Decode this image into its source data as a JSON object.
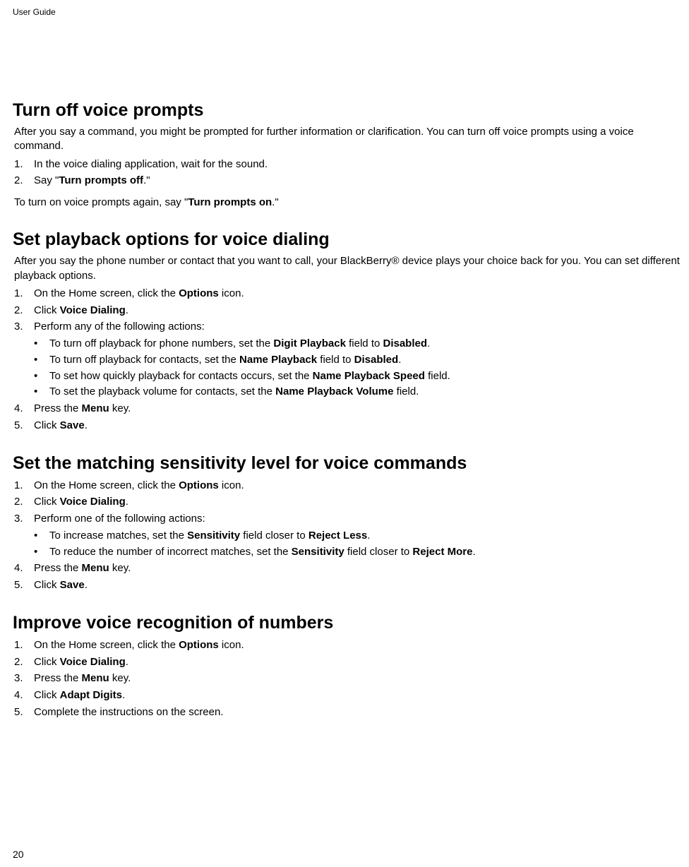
{
  "header": {
    "label": "User Guide"
  },
  "page_number": "20",
  "sections": [
    {
      "heading": "Turn off voice prompts",
      "intro": "After you say a command, you might be prompted for further information or clarification. You can turn off voice prompts using a voice command.",
      "steps": [
        {
          "n": "1.",
          "runs": [
            {
              "t": "In the voice dialing application, wait for the sound."
            }
          ]
        },
        {
          "n": "2.",
          "runs": [
            {
              "t": "Say \""
            },
            {
              "t": "Turn prompts off",
              "b": true
            },
            {
              "t": ".\""
            }
          ]
        }
      ],
      "note_runs": [
        {
          "t": "To turn on voice prompts again, say \""
        },
        {
          "t": "Turn prompts on",
          "b": true
        },
        {
          "t": ".\""
        }
      ]
    },
    {
      "heading": "Set playback options for voice dialing",
      "intro": "After you say the phone number or contact that you want to call, your BlackBerry® device plays your choice back for you. You can set different playback options.",
      "steps": [
        {
          "n": "1.",
          "runs": [
            {
              "t": "On the Home screen, click the "
            },
            {
              "t": "Options",
              "b": true
            },
            {
              "t": " icon."
            }
          ]
        },
        {
          "n": "2.",
          "runs": [
            {
              "t": "Click "
            },
            {
              "t": "Voice Dialing",
              "b": true
            },
            {
              "t": "."
            }
          ]
        },
        {
          "n": "3.",
          "runs": [
            {
              "t": "Perform any of the following actions:"
            }
          ],
          "sub": [
            [
              {
                "t": "To turn off playback for phone numbers, set the "
              },
              {
                "t": "Digit Playback",
                "b": true
              },
              {
                "t": " field to "
              },
              {
                "t": "Disabled",
                "b": true
              },
              {
                "t": "."
              }
            ],
            [
              {
                "t": "To turn off playback for contacts, set the "
              },
              {
                "t": "Name Playback",
                "b": true
              },
              {
                "t": " field to "
              },
              {
                "t": "Disabled",
                "b": true
              },
              {
                "t": "."
              }
            ],
            [
              {
                "t": "To set how quickly playback for contacts occurs, set the "
              },
              {
                "t": "Name Playback Speed",
                "b": true
              },
              {
                "t": " field."
              }
            ],
            [
              {
                "t": "To set the playback volume for contacts, set the "
              },
              {
                "t": "Name Playback Volume",
                "b": true
              },
              {
                "t": " field."
              }
            ]
          ]
        },
        {
          "n": "4.",
          "runs": [
            {
              "t": "Press the "
            },
            {
              "t": "Menu",
              "b": true
            },
            {
              "t": " key."
            }
          ]
        },
        {
          "n": "5.",
          "runs": [
            {
              "t": "Click "
            },
            {
              "t": "Save",
              "b": true
            },
            {
              "t": "."
            }
          ]
        }
      ]
    },
    {
      "heading": "Set the matching sensitivity level for voice commands",
      "steps": [
        {
          "n": "1.",
          "runs": [
            {
              "t": "On the Home screen, click the "
            },
            {
              "t": "Options",
              "b": true
            },
            {
              "t": " icon."
            }
          ]
        },
        {
          "n": "2.",
          "runs": [
            {
              "t": "Click "
            },
            {
              "t": "Voice Dialing",
              "b": true
            },
            {
              "t": "."
            }
          ]
        },
        {
          "n": "3.",
          "runs": [
            {
              "t": "Perform one of the following actions:"
            }
          ],
          "sub": [
            [
              {
                "t": "To increase matches, set the "
              },
              {
                "t": "Sensitivity",
                "b": true
              },
              {
                "t": " field closer to "
              },
              {
                "t": "Reject Less",
                "b": true
              },
              {
                "t": "."
              }
            ],
            [
              {
                "t": "To reduce the number of incorrect matches, set the "
              },
              {
                "t": "Sensitivity",
                "b": true
              },
              {
                "t": " field closer to "
              },
              {
                "t": "Reject More",
                "b": true
              },
              {
                "t": "."
              }
            ]
          ]
        },
        {
          "n": "4.",
          "runs": [
            {
              "t": "Press the "
            },
            {
              "t": "Menu",
              "b": true
            },
            {
              "t": " key."
            }
          ]
        },
        {
          "n": "5.",
          "runs": [
            {
              "t": "Click "
            },
            {
              "t": "Save",
              "b": true
            },
            {
              "t": "."
            }
          ]
        }
      ]
    },
    {
      "heading": "Improve voice recognition of numbers",
      "steps": [
        {
          "n": "1.",
          "runs": [
            {
              "t": "On the Home screen, click the "
            },
            {
              "t": "Options",
              "b": true
            },
            {
              "t": " icon."
            }
          ]
        },
        {
          "n": "2.",
          "runs": [
            {
              "t": "Click "
            },
            {
              "t": "Voice Dialing",
              "b": true
            },
            {
              "t": "."
            }
          ]
        },
        {
          "n": "3.",
          "runs": [
            {
              "t": "Press the "
            },
            {
              "t": "Menu",
              "b": true
            },
            {
              "t": " key."
            }
          ]
        },
        {
          "n": "4.",
          "runs": [
            {
              "t": "Click "
            },
            {
              "t": "Adapt Digits",
              "b": true
            },
            {
              "t": "."
            }
          ]
        },
        {
          "n": "5.",
          "runs": [
            {
              "t": "Complete the instructions on the screen."
            }
          ]
        }
      ]
    }
  ]
}
